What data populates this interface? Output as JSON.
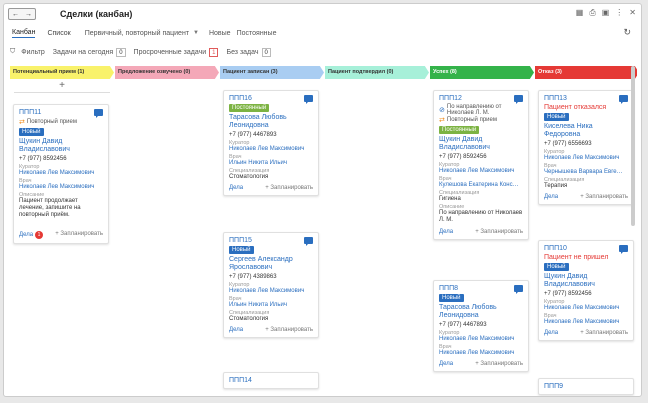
{
  "window": {
    "title": "Сделки (канбан)",
    "back": "←",
    "forward": "→"
  },
  "views": {
    "kanban": "Канбан",
    "list": "Список",
    "select": "Первичный, повторный пациент",
    "new": "Новые",
    "permanent": "Постоянные"
  },
  "filters": {
    "filter": "Фильтр",
    "today": "Задачи на сегодня",
    "today_count": "0",
    "overdue": "Просроченные задачи",
    "overdue_count": "1",
    "notasks": "Без задач",
    "notasks_count": "0"
  },
  "colors": {
    "c1": "#f9f26b",
    "c2": "#f4a8b8",
    "c3": "#a9cdf2",
    "c4": "#a7f0d9",
    "c5": "#34b34a",
    "c6": "#e53935"
  },
  "columns": [
    {
      "title": "Потенциальный прием (1)"
    },
    {
      "title": "Предложение озвучено (0)"
    },
    {
      "title": "Пациент записан (3)"
    },
    {
      "title": "Пациент подтвердил (0)"
    },
    {
      "title": "Успех (8)"
    },
    {
      "title": "Отказ (3)"
    }
  ],
  "labels": {
    "curator": "Куратор",
    "doctor": "Врач",
    "spec": "Специализация",
    "desc": "Описание",
    "deals": "Дела",
    "plan": "+ Запланировать",
    "add": "+"
  },
  "cards": {
    "c0a": {
      "num": "ППП11",
      "repeat": "Повторный прием",
      "badge": "Новый",
      "name": "Щукин Давид Владиславович",
      "phone": "+7 (977) 8592456",
      "curator": "Николаев Лев Максимович",
      "doctor": "Николаев Лев Максимович",
      "desc": "Пациент продолжает лечение, запишите на повторный приём.",
      "deals_count": "1"
    },
    "c2a": {
      "num": "ППП16",
      "badge": "Постоянный",
      "name": "Тарасова Любовь Леонидовна",
      "phone": "+7 (977) 4467893",
      "curator": "Николаев Лев Максимович",
      "doctor": "Ильин Никита Ильич",
      "spec": "Стоматология"
    },
    "c2b": {
      "num": "ППП15",
      "badge": "Новый",
      "name": "Сергеев Александр Ярославович",
      "phone": "+7 (977) 4389863",
      "curator": "Николаев Лев Максимович",
      "doctor": "Ильин Никита Ильич",
      "spec": "Стоматология"
    },
    "c2c": {
      "num": "ППП14"
    },
    "c4a": {
      "num": "ППП12",
      "direction": "По направлению от Николаев Л. М.",
      "repeat": "Повторный прием",
      "badge": "Постоянный",
      "name": "Щукин Давид Владиславович",
      "phone": "+7 (977) 8592456",
      "curator": "Николаев Лев Максимович",
      "doctor": "Кулешова Екатерина Конс…",
      "spec": "Гигиена",
      "desc": "По направлению от Николаев Л. М."
    },
    "c4b": {
      "num": "ППП8",
      "badge": "Новый",
      "name": "Тарасова Любовь Леонидовна",
      "phone": "+7 (977) 4467893",
      "curator": "Николаев Лев Максимович",
      "doctor": "Николаев Лев Максимович"
    },
    "c5a": {
      "num": "ППП13",
      "status": "Пациент отказался",
      "badge": "Новый",
      "name": "Киселева Ника Федоровна",
      "phone": "+7 (977) 6556693",
      "curator": "Николаев Лев Максимович",
      "doctor": "Чернышева Варвара Евге…",
      "spec": "Терапия"
    },
    "c5b": {
      "num": "ППП10",
      "status": "Пациент не пришел",
      "badge": "Новый",
      "name": "Щукин Давид Владиславович",
      "phone": "+7 (977) 8592456",
      "curator": "Николаев Лев Максимович",
      "doctor": "Николаев Лев Максимович"
    },
    "c5c": {
      "num": "ППП9"
    }
  }
}
